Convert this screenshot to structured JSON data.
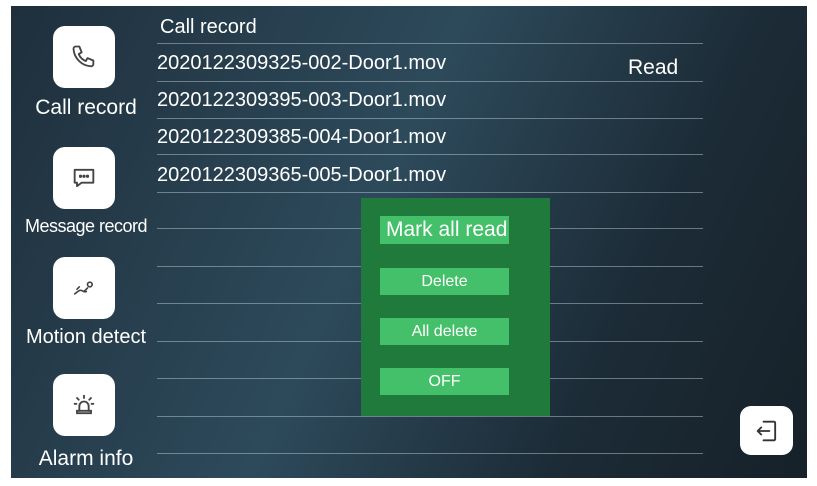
{
  "sidebar": {
    "items": [
      {
        "label": "Call record",
        "icon": "phone-icon"
      },
      {
        "label": "Message record",
        "icon": "message-icon"
      },
      {
        "label": "Motion detect",
        "icon": "motion-icon"
      },
      {
        "label": "Alarm info",
        "icon": "alarm-icon"
      }
    ]
  },
  "main": {
    "title": "Call record",
    "records": [
      "2020122309325-002-Door1.mov",
      "2020122309395-003-Door1.mov",
      "2020122309385-004-Door1.mov",
      "2020122309365-005-Door1.mov"
    ],
    "first_record_status": "Read"
  },
  "context_menu": {
    "mark_all_read": "Mark all read",
    "delete": "Delete",
    "all_delete": "All delete",
    "off": "OFF"
  },
  "back_button": {
    "icon": "exit-icon"
  },
  "colors": {
    "menu_background": "#1f7a3c",
    "menu_button": "#45c06a",
    "screen_background": "#2d4a5b"
  }
}
